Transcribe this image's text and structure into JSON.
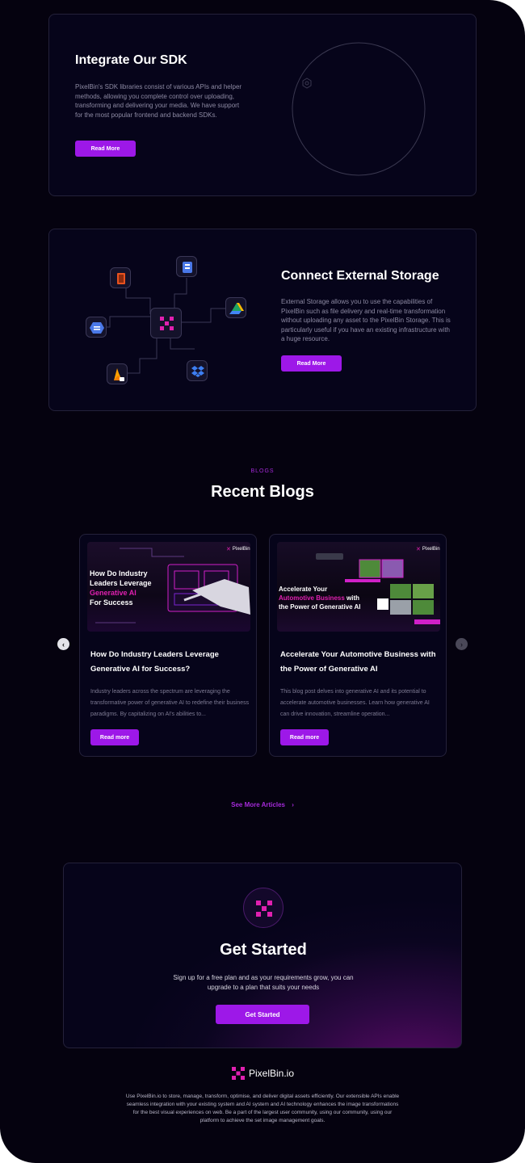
{
  "sdk": {
    "title": "Integrate Our SDK",
    "description": "PixelBin's SDK libraries consist of various APIs and helper methods, allowing you complete control over uploading, transforming and delivering your media. We have support for the most popular frontend and backend SDKs.",
    "button": "Read More"
  },
  "storage": {
    "title": "Connect External Storage",
    "description": "External Storage allows you to use the capabilities of PixelBin such as file delivery and real-time transformation without uploading any asset to the PixelBin Storage. This is particularly useful if you have an existing infrastructure with a huge resource.",
    "button": "Read More"
  },
  "blogs": {
    "eyebrow": "BLOGS",
    "title": "Recent Blogs",
    "see_more": "See More Articles",
    "items": [
      {
        "image_heading_1": "How Do Industry",
        "image_heading_2": "Leaders Leverage",
        "image_heading_3": "Generative AI",
        "image_heading_4": "For Success",
        "logo": "PixelBin",
        "title": "How Do Industry Leaders Leverage Generative AI for Success?",
        "excerpt": "Industry leaders across the spectrum are leveraging the transformative power of generative AI to redefine their business paradigms. By capitalizing on AI's abilities to...",
        "button": "Read more"
      },
      {
        "image_heading_1": "Accelerate Your",
        "image_heading_2": "Automotive Business",
        "image_heading_3": "with",
        "image_heading_4": "the Power of Generative AI",
        "logo": "PixelBin",
        "title": "Accelerate Your Automotive Business with the Power of Generative AI",
        "excerpt": "This blog post delves into generative AI and its potential to accelerate automotive businesses. Learn how generative AI can drive innovation, streamline operation...",
        "button": "Read more"
      }
    ]
  },
  "get_started": {
    "title": "Get Started",
    "description": "Sign up for a free plan and as your requirements grow, you can upgrade to a plan that suits your needs",
    "button": "Get Started"
  },
  "footer": {
    "brand": "PixelBin.io",
    "description": "Use PixelBin.io to store, manage, transform, optimise, and deliver digital assets efficiently. Our extensible APIs enable seamless integration with your existing system and AI system and AI technology enhances the image transformations for the best visual experiences on web. Be a part of the largest user community, using our community, using our platform to achieve the set image management goals."
  },
  "colors": {
    "accent": "#9d18e8",
    "brand_pink": "#e020b0",
    "background": "#05020f"
  }
}
